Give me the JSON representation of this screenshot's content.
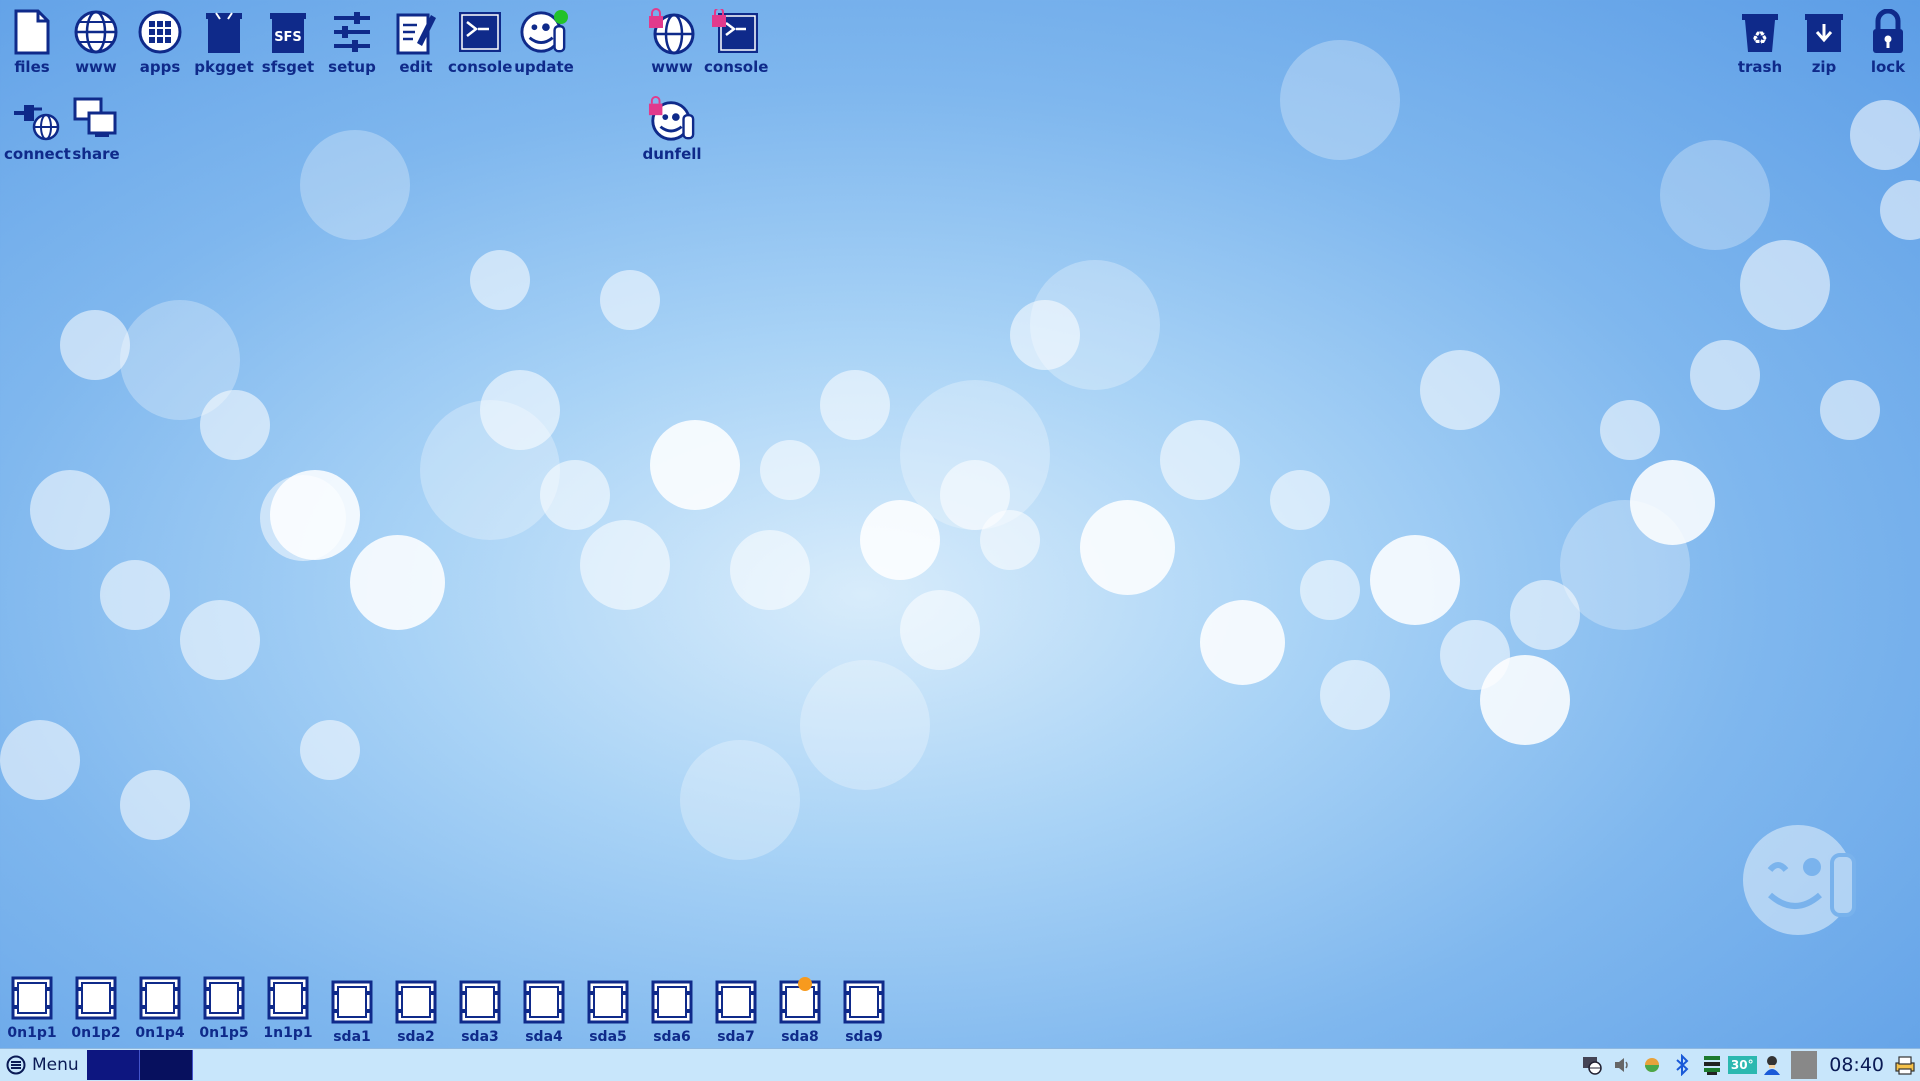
{
  "desktop": {
    "top_icons": [
      {
        "label": "files",
        "icon": "file-icon"
      },
      {
        "label": "www",
        "icon": "globe-icon"
      },
      {
        "label": "apps",
        "icon": "apps-grid-icon"
      },
      {
        "label": "pkgget",
        "icon": "package-icon"
      },
      {
        "label": "sfsget",
        "icon": "sfs-package-icon"
      },
      {
        "label": "setup",
        "icon": "sliders-icon"
      },
      {
        "label": "edit",
        "icon": "edit-document-icon"
      },
      {
        "label": "console",
        "icon": "terminal-icon"
      },
      {
        "label": "update",
        "icon": "update-smiley-icon"
      }
    ],
    "second_row": [
      {
        "label": "connect",
        "icon": "network-connect-icon"
      },
      {
        "label": "share",
        "icon": "share-computers-icon"
      }
    ],
    "locked_apps": [
      {
        "label": "www",
        "icon": "locked-globe-icon"
      },
      {
        "label": "console",
        "icon": "locked-terminal-icon"
      },
      {
        "label": "dunfell",
        "icon": "locked-smiley-icon"
      }
    ],
    "right_icons": [
      {
        "label": "trash",
        "icon": "trash-icon"
      },
      {
        "label": "zip",
        "icon": "zip-icon"
      },
      {
        "label": "lock",
        "icon": "lock-icon"
      }
    ],
    "drives": [
      {
        "label": "0n1p1"
      },
      {
        "label": "0n1p2"
      },
      {
        "label": "0n1p4"
      },
      {
        "label": "0n1p5"
      },
      {
        "label": "1n1p1"
      },
      {
        "label": "sda1"
      },
      {
        "label": "sda2"
      },
      {
        "label": "sda3"
      },
      {
        "label": "sda4"
      },
      {
        "label": "sda5"
      },
      {
        "label": "sda6"
      },
      {
        "label": "sda7"
      },
      {
        "label": "sda8",
        "mounted": true
      },
      {
        "label": "sda9"
      }
    ]
  },
  "taskbar": {
    "menu_label": "Menu",
    "temperature": "30°",
    "clock": "08:40"
  },
  "colors": {
    "icon_blue": "#0f2a8a",
    "update_dot": "#22c22a",
    "mount_dot": "#f79a1e",
    "lock_pink": "#e23a8c"
  }
}
